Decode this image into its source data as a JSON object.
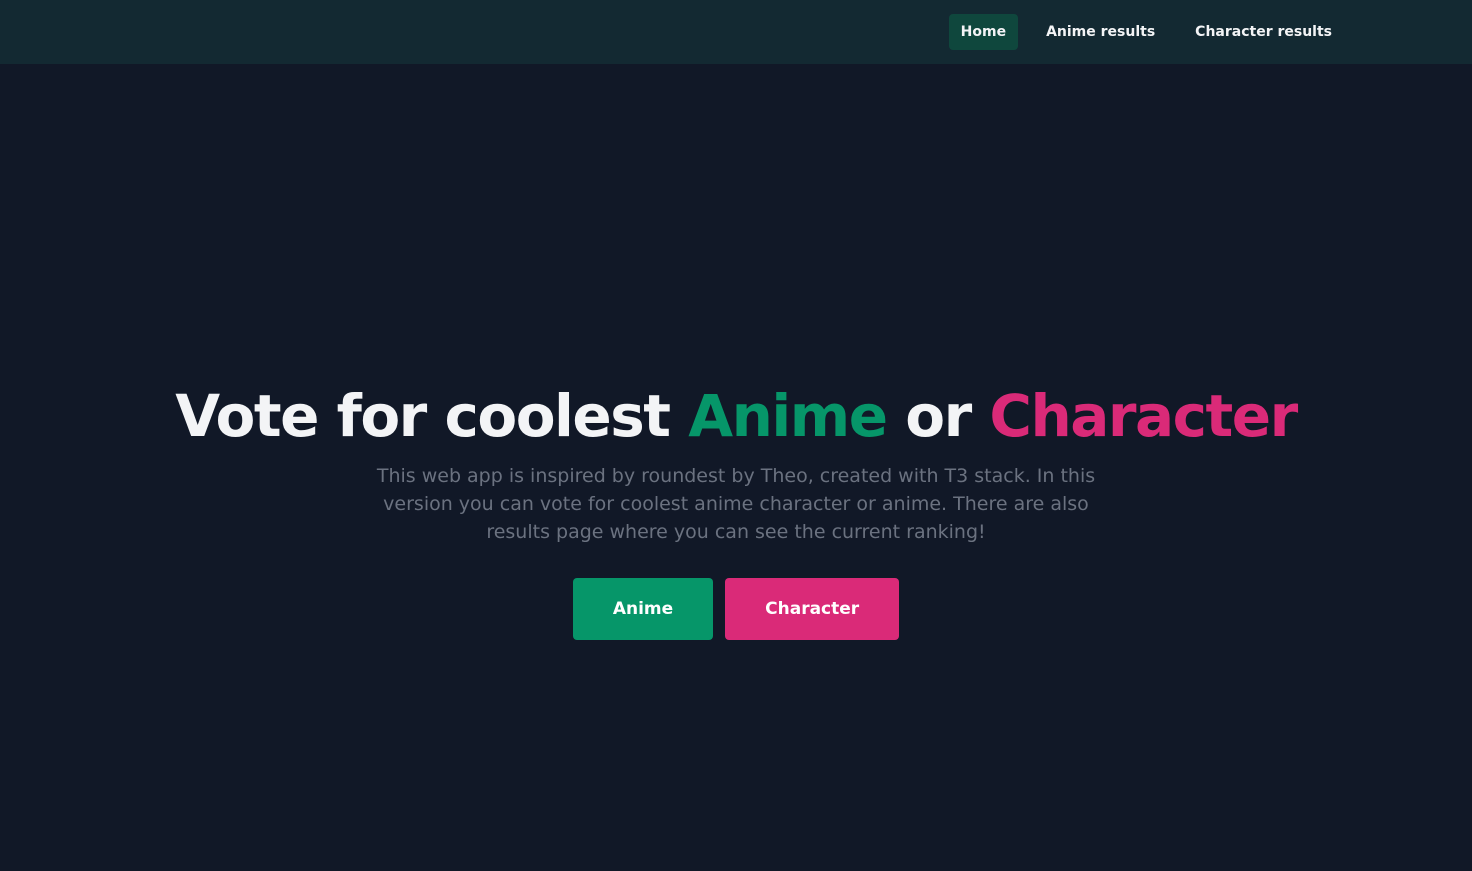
{
  "nav": {
    "items": [
      {
        "label": "Home",
        "active": true
      },
      {
        "label": "Anime results",
        "active": false
      },
      {
        "label": "Character results",
        "active": false
      }
    ]
  },
  "hero": {
    "title_part1": "Vote for coolest ",
    "title_anime": "Anime",
    "title_or": " or ",
    "title_character": "Character",
    "description": "This web app is inspired by roundest by Theo, created with T3 stack. In this version you can vote for coolest anime character or anime. There are also results page where you can see the current ranking!"
  },
  "buttons": {
    "anime_label": "Anime",
    "character_label": "Character"
  },
  "colors": {
    "background": "#111827",
    "navbar": "#132932",
    "nav_active": "#0f473d",
    "anime_accent": "#069669",
    "character_accent": "#da2a78",
    "muted_text": "#6b7280"
  }
}
